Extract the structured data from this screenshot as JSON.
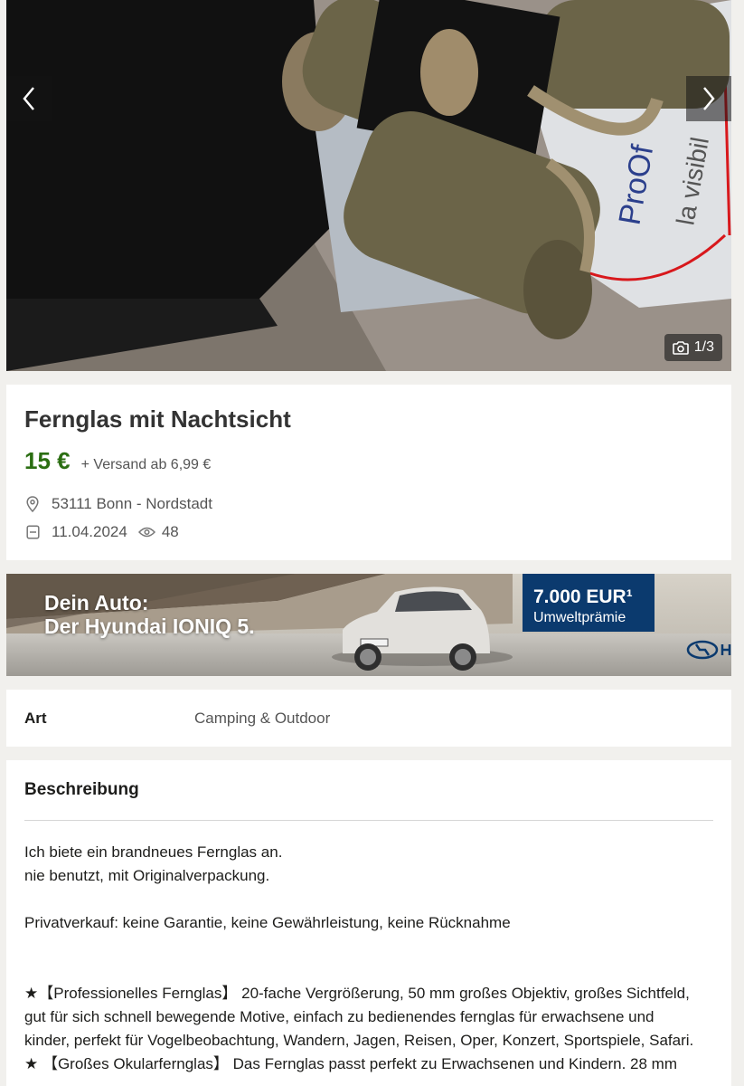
{
  "gallery": {
    "counter": "1/3",
    "prev_icon": "chevron-left-icon",
    "next_icon": "chevron-right-icon",
    "camera_icon": "camera-icon"
  },
  "listing": {
    "title": "Fernglas mit Nachtsicht",
    "price": "15 €",
    "shipping": "+ Versand ab 6,99 €",
    "location": "53111 Bonn - Nordstadt",
    "date": "11.04.2024",
    "views": "48",
    "price_color": "#2b6e12"
  },
  "ad": {
    "line1": "Dein Auto:",
    "line2": "Der Hyundai IONIQ 5.",
    "promo_amount": "7.000 EUR¹",
    "promo_label": "Umweltprämie",
    "brand_color": "#0b3a6e"
  },
  "attributes": {
    "key": "Art",
    "value": "Camping & Outdoor"
  },
  "description": {
    "heading": "Beschreibung",
    "line1": "Ich biete ein brandneues Fernglas an.",
    "line2": "nie benutzt, mit Originalverpackung.",
    "line3": "Privatverkauf: keine Garantie, keine Gewährleistung, keine Rücknahme",
    "line4": "★【Professionelles Fernglas】 20-fache Vergrößerung, 50 mm großes Objektiv, großes Sichtfeld,",
    "line5": "gut für sich schnell bewegende Motive, einfach zu bedienendes fernglas für erwachsene und",
    "line6": "kinder, perfekt für Vogelbeobachtung, Wandern, Jagen, Reisen, Oper, Konzert, Sportspiele, Safari.",
    "line7": "★ 【Großes Okularfernglas】 Das Fernglas passt perfekt zu Erwachsenen und Kindern. 28 mm"
  }
}
